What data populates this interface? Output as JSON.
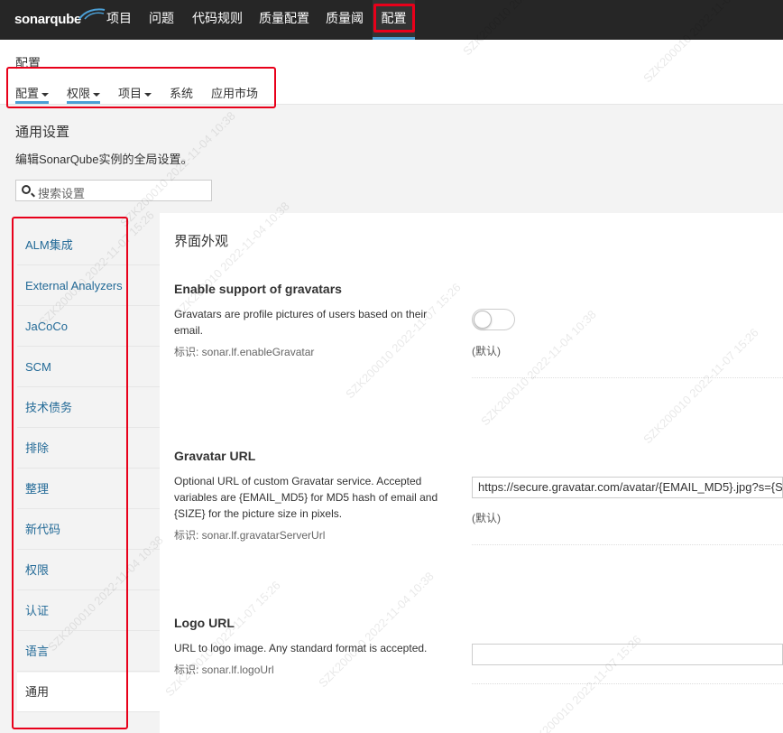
{
  "app": {
    "logo": "sonarqube"
  },
  "topnav": {
    "items": [
      "项目",
      "问题",
      "代码规则",
      "质量配置",
      "质量阈",
      "配置"
    ]
  },
  "header": {
    "title": "配置",
    "subnav": [
      "配置",
      "权限",
      "项目",
      "系统",
      "应用市场"
    ]
  },
  "general": {
    "title": "通用设置",
    "description": "编辑SonarQube实例的全局设置。",
    "search_placeholder": "搜索设置"
  },
  "sidebar": {
    "items": [
      "ALM集成",
      "External Analyzers",
      "JaCoCo",
      "SCM",
      "技术债务",
      "排除",
      "整理",
      "新代码",
      "权限",
      "认证",
      "语言",
      "通用"
    ]
  },
  "content": {
    "category_title": "界面外观",
    "settings": [
      {
        "name": "Enable support of gravatars",
        "description": "Gravatars are profile pictures of users based on their email.",
        "key": "标识: sonar.lf.enableGravatar",
        "default": "(默认)",
        "enabled": false
      },
      {
        "name": "Gravatar URL",
        "description": "Optional URL of custom Gravatar service. Accepted variables are {EMAIL_MD5} for MD5 hash of email and {SIZE} for the picture size in pixels.",
        "key": "标识: sonar.lf.gravatarServerUrl",
        "value": "https://secure.gravatar.com/avatar/{EMAIL_MD5}.jpg?s={S",
        "default": "(默认)"
      },
      {
        "name": "Logo URL",
        "description": "URL to logo image. Any standard format is accepted.",
        "key": "标识: sonar.lf.logoUrl",
        "value": ""
      }
    ]
  },
  "watermark": {
    "text_a": "SZK200010 2022-11-04 10:38",
    "text_b": "SZK200010 2022-11-07 15:26"
  },
  "colors": {
    "topbar": "#262626",
    "accent": "#4b9fd5",
    "highlight_box": "#e8001a",
    "link": "#236a97"
  }
}
